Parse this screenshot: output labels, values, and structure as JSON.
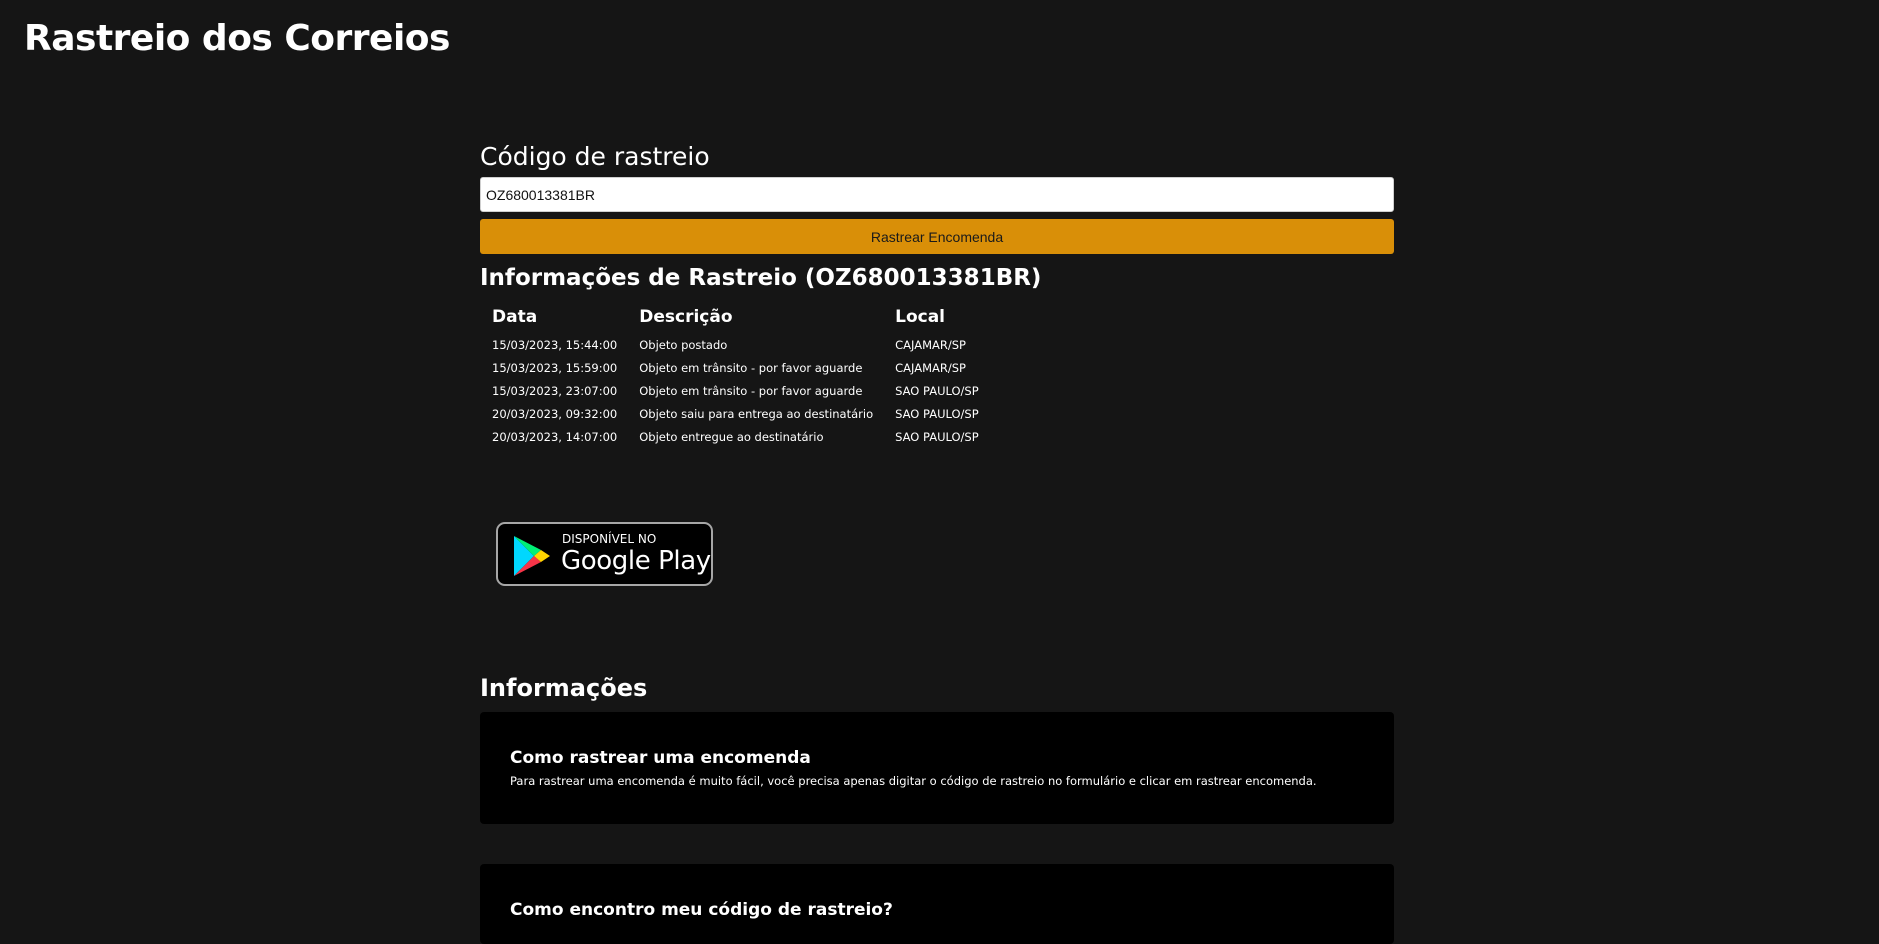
{
  "header": {
    "title": "Rastreio dos Correios"
  },
  "form": {
    "label": "Código de rastreio",
    "input_value": "OZ680013381BR",
    "button_label": "Rastrear Encomenda"
  },
  "results": {
    "heading": "Informações de Rastreio (OZ680013381BR)",
    "columns": [
      "Data",
      "Descrição",
      "Local"
    ],
    "rows": [
      [
        "15/03/2023, 15:44:00",
        "Objeto postado",
        "CAJAMAR/SP"
      ],
      [
        "15/03/2023, 15:59:00",
        "Objeto em trânsito - por favor aguarde",
        "CAJAMAR/SP"
      ],
      [
        "15/03/2023, 23:07:00",
        "Objeto em trânsito - por favor aguarde",
        "SAO PAULO/SP"
      ],
      [
        "20/03/2023, 09:32:00",
        "Objeto saiu para entrega ao destinatário",
        "SAO PAULO/SP"
      ],
      [
        "20/03/2023, 14:07:00",
        "Objeto entregue ao destinatário",
        "SAO PAULO/SP"
      ]
    ]
  },
  "badge": {
    "top_text": "DISPONÍVEL NO",
    "store_text": "Google Play",
    "icon": "google-play-icon"
  },
  "info": {
    "heading": "Informações",
    "cards": [
      {
        "title": "Como rastrear uma encomenda",
        "body": "Para rastrear uma encomenda é muito fácil, você precisa apenas digitar o código de rastreio no formulário e clicar em rastrear encomenda."
      },
      {
        "title": "Como encontro meu código de rastreio?"
      }
    ]
  },
  "colors": {
    "background": "#151515",
    "accent": "#d98f08",
    "card": "#000000"
  }
}
